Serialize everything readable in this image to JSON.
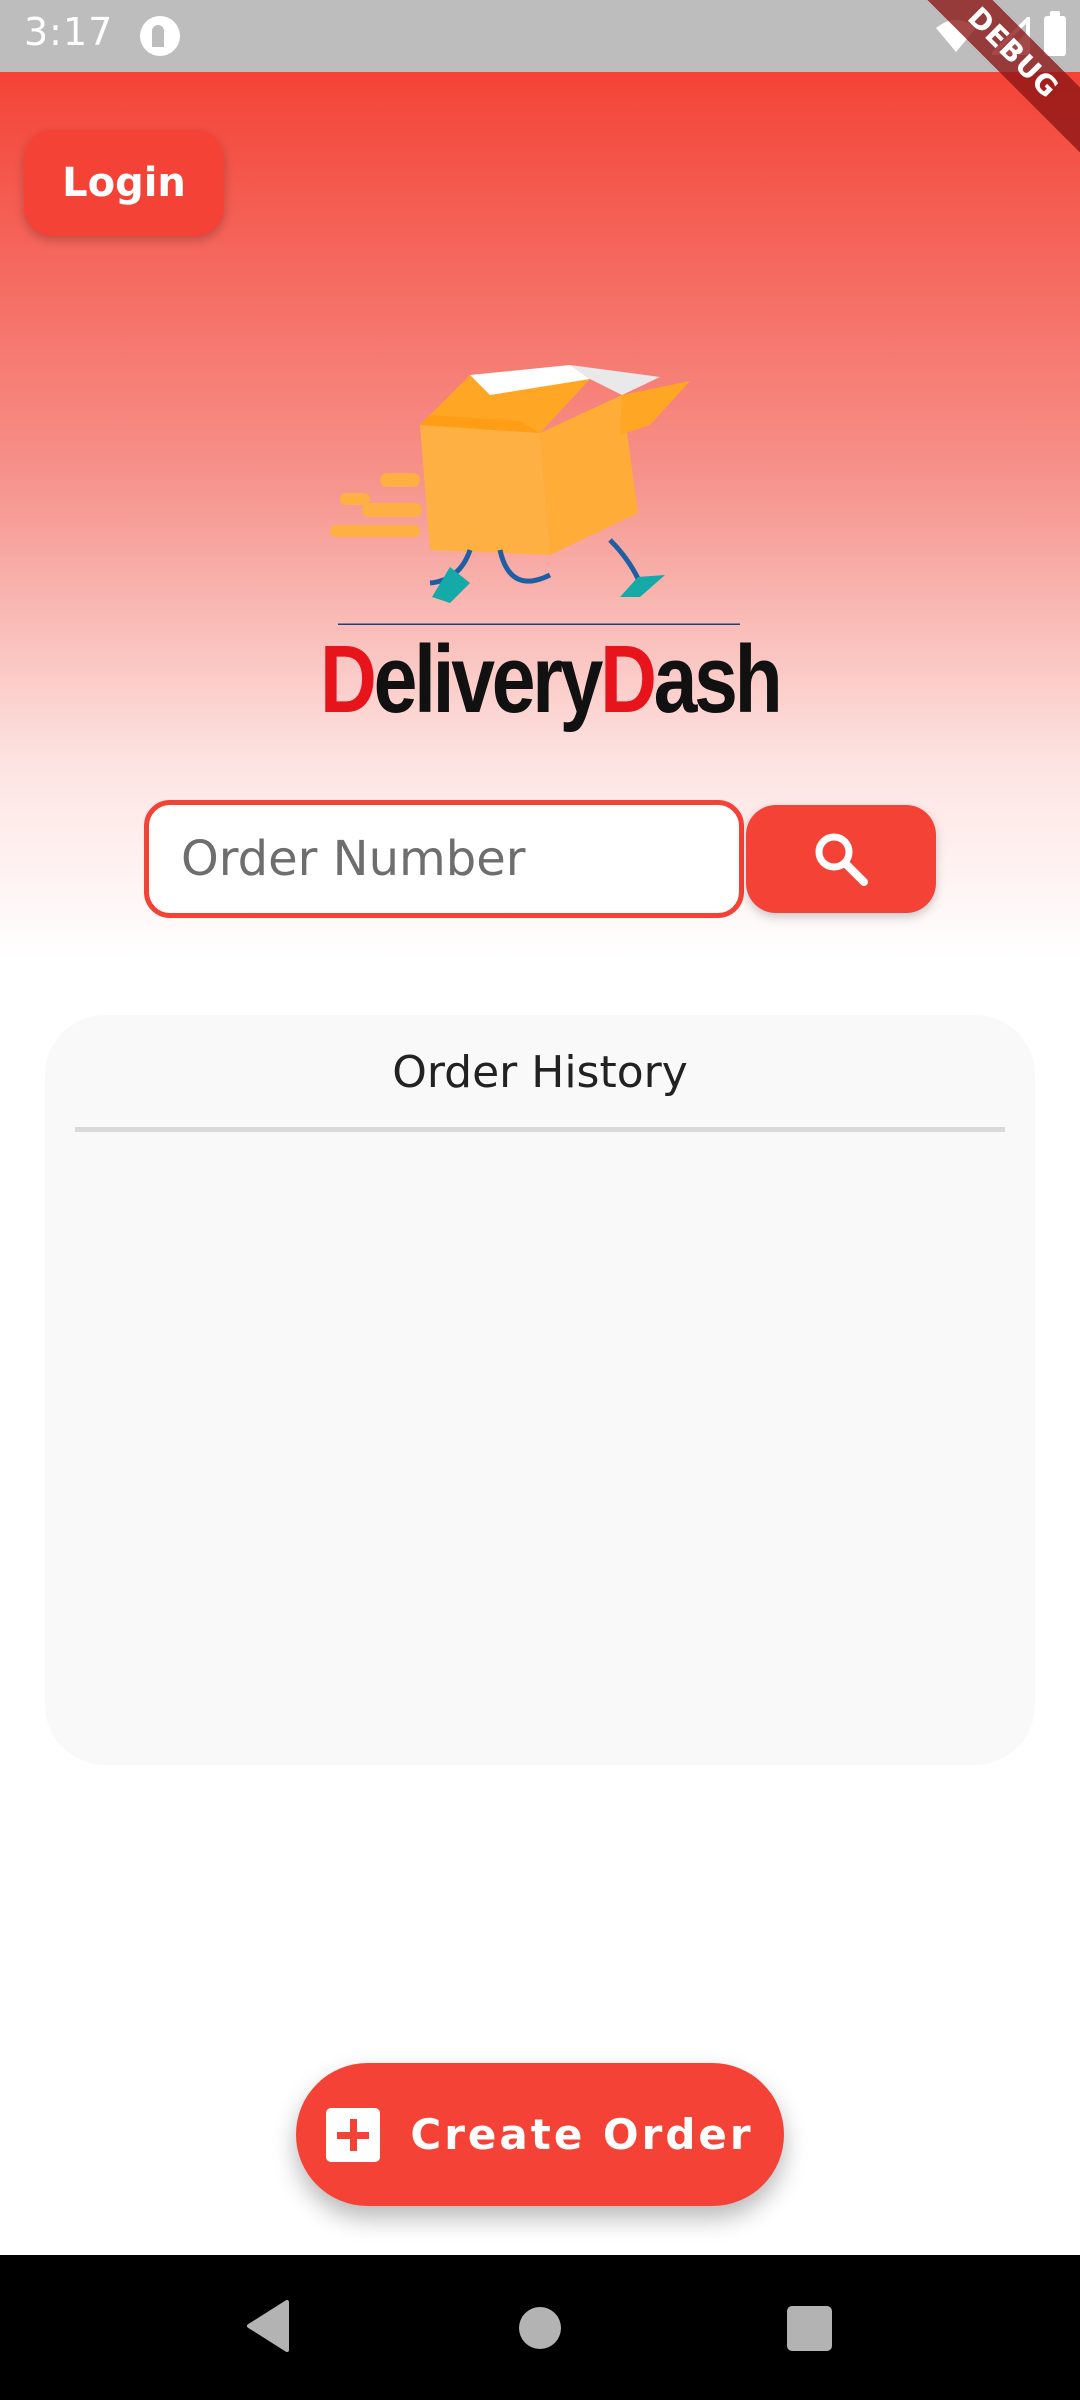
{
  "status_bar": {
    "time": "3:17",
    "icons": [
      "app-notification-icon",
      "wifi-icon",
      "signal-icon",
      "battery-icon"
    ]
  },
  "debug_banner": {
    "label": "DEBUG"
  },
  "header": {
    "login_label": "Login",
    "logo": {
      "part1_initial": "D",
      "part1_rest": "elivery",
      "part2_initial": "D",
      "part2_rest": "ash"
    },
    "search": {
      "placeholder": "Order Number",
      "value": "",
      "button_icon": "search-icon"
    }
  },
  "order_history": {
    "title": "Order History",
    "orders": []
  },
  "create_order": {
    "label": "Create Order",
    "icon": "add-box-icon"
  },
  "nav_bar": {
    "buttons": [
      "back-icon",
      "home-icon",
      "recents-icon"
    ]
  },
  "colors": {
    "accent": "#f44336",
    "logo_red": "#e8141b",
    "box_orange": "#ffb043",
    "card_bg": "#f9f9f9"
  }
}
